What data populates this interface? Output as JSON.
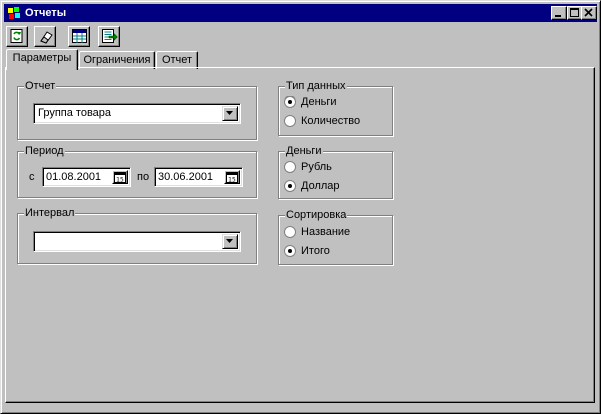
{
  "window": {
    "title": "Отчеты"
  },
  "toolbar": [
    {
      "name": "refresh-button",
      "icon": "refresh-icon"
    },
    {
      "name": "eraser-button",
      "icon": "eraser-icon"
    },
    {
      "name": "table-button",
      "icon": "table-icon"
    },
    {
      "name": "export-button",
      "icon": "export-icon"
    }
  ],
  "tabs": [
    {
      "label": "Параметры",
      "active": true
    },
    {
      "label": "Ограничения",
      "active": false
    },
    {
      "label": "Отчет",
      "active": false
    }
  ],
  "report": {
    "label": "Отчет",
    "value": "Группа товара"
  },
  "period": {
    "label": "Период",
    "from_label": "с",
    "from_value": "01.08.2001",
    "to_label": "по",
    "to_value": "30.06.2001",
    "calendar_icon_text": "15"
  },
  "interval": {
    "label": "Интервал",
    "value": ""
  },
  "data_type": {
    "label": "Тип данных",
    "options": [
      {
        "label": "Деньги",
        "checked": true
      },
      {
        "label": "Количество",
        "checked": false
      }
    ]
  },
  "money": {
    "label": "Деньги",
    "options": [
      {
        "label": "Рубль",
        "checked": false
      },
      {
        "label": "Доллар",
        "checked": true
      }
    ]
  },
  "sort": {
    "label": "Сортировка",
    "options": [
      {
        "label": "Название",
        "checked": false
      },
      {
        "label": "Итого",
        "checked": true
      }
    ]
  },
  "colors": {
    "title_bar": "#000080",
    "face": "#c0c0c0"
  }
}
